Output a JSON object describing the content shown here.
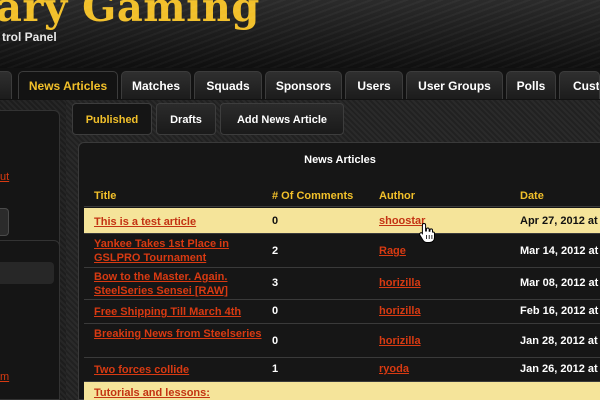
{
  "header": {
    "site_title": "ary Gaming",
    "subtitle": "trol Panel"
  },
  "nav": {
    "tabs": [
      {
        "label": "",
        "active": false
      },
      {
        "label": "News Articles",
        "active": true
      },
      {
        "label": "Matches",
        "active": false
      },
      {
        "label": "Squads",
        "active": false
      },
      {
        "label": "Sponsors",
        "active": false
      },
      {
        "label": "Users",
        "active": false
      },
      {
        "label": "User Groups",
        "active": false
      },
      {
        "label": "Polls",
        "active": false
      },
      {
        "label": "Custo",
        "active": false
      }
    ]
  },
  "sidebar": {
    "links": [
      "ut",
      "m"
    ]
  },
  "subtabs": [
    {
      "label": "Published",
      "active": true
    },
    {
      "label": "Drafts",
      "active": false
    },
    {
      "label": "Add News Article",
      "active": false
    }
  ],
  "panel": {
    "title": "News Articles",
    "columns": [
      "Title",
      "# Of Comments",
      "Author",
      "Date"
    ],
    "rows": [
      {
        "title": "This is a test article",
        "comments": "0",
        "author": "shoostar",
        "date": "Apr 27, 2012 at",
        "highlight": true
      },
      {
        "title": "Yankee Takes 1st Place in GSLPRO Tournament",
        "comments": "2",
        "author": "Rage",
        "date": "Mar 14, 2012 at",
        "highlight": false
      },
      {
        "title": "Bow to the Master. Again. SteelSeries Sensei [RAW]",
        "comments": "3",
        "author": "horizilla",
        "date": "Mar 08, 2012 at",
        "highlight": false
      },
      {
        "title": "Free Shipping Till March 4th",
        "comments": "0",
        "author": "horizilla",
        "date": "Feb 16, 2012 at",
        "highlight": false
      },
      {
        "title": "Breaking News from Steelseries",
        "comments": "0",
        "author": "horizilla",
        "date": "Jan 28, 2012 at",
        "highlight": false
      },
      {
        "title": "Two forces collide",
        "comments": "1",
        "author": "ryoda",
        "date": "Jan 26, 2012 at",
        "highlight": false
      },
      {
        "title": "Tutorials and lessons:",
        "comments": "",
        "author": "",
        "date": "",
        "highlight": true
      }
    ]
  },
  "colors": {
    "accent_gold": "#f2c02a",
    "link_red": "#d83a12",
    "highlight_row": "#f5e49a",
    "background": "#1a1a1a"
  },
  "icons": {
    "cursor": "hand-pointer-icon"
  }
}
